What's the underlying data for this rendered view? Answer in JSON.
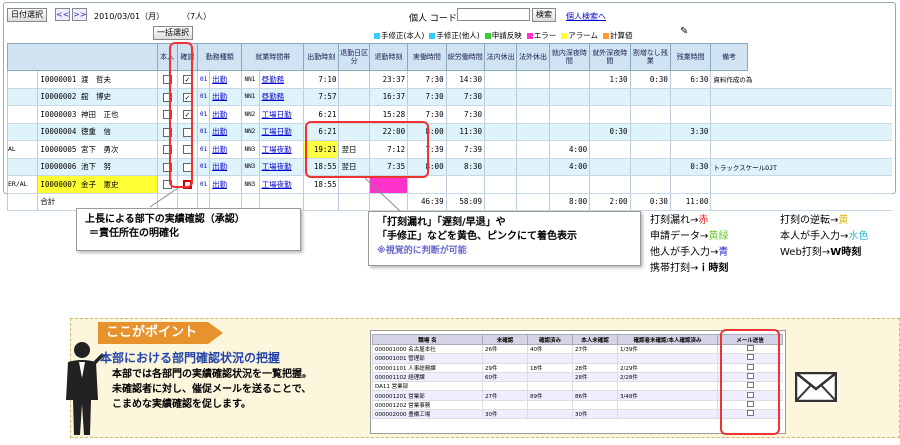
{
  "toolbar": {
    "date_select": "日付選択",
    "prev": "<<",
    "next": ">>",
    "date": "2010/03/01（月）",
    "count": "（7人）",
    "individual_code": "個人 コード",
    "search": "検索",
    "person_search": "個人検索へ",
    "bulk_select": "一括選択"
  },
  "legend": [
    {
      "label": "手修正(本人)",
      "color": "#33ccff"
    },
    {
      "label": "手修正(他人)",
      "color": "#33ccff"
    },
    {
      "label": "申請反映",
      "color": "#33cc33"
    },
    {
      "label": "エラー",
      "color": "#ff33cc"
    },
    {
      "label": "アラーム",
      "color": "#ffff33"
    },
    {
      "label": "計算値",
      "color": "#ff9933"
    }
  ],
  "columns": [
    "本人",
    "確認",
    "勤務種類",
    "就業時間帯",
    "出勤時刻",
    "退勤日区分",
    "退勤時刻",
    "実働時間",
    "総労働時間",
    "法内休出",
    "法外休出",
    "就内深夜時間",
    "就外深夜時間",
    "割増なし残業",
    "残業時間",
    "備考"
  ],
  "rows": [
    {
      "pre": "",
      "id": "I0000001",
      "name": "渡　哲夫",
      "confirm": "✓",
      "c1": "01",
      "kind": "出勤",
      "code": "NN1",
      "zone": "昼勤務",
      "in": "7:10",
      "day": "",
      "out": "23:37",
      "work": "7:30",
      "total": "14:30",
      "h1": "",
      "h2": "",
      "n1": "",
      "n2": "1:30",
      "ot0": "0:30",
      "ot": "6:30",
      "note": "資料作成の為"
    },
    {
      "pre": "",
      "id": "I0000002",
      "name": "舘　博史",
      "confirm": "✓",
      "c1": "01",
      "kind": "出勤",
      "code": "NN1",
      "zone": "昼勤務",
      "in": "7:57",
      "day": "",
      "out": "16:37",
      "work": "7:30",
      "total": "7:30",
      "h1": "",
      "h2": "",
      "n1": "",
      "n2": "",
      "ot0": "",
      "ot": "",
      "note": ""
    },
    {
      "pre": "",
      "id": "I0000003",
      "name": "神田　正也",
      "confirm": "✓",
      "c1": "01",
      "kind": "出勤",
      "code": "NN2",
      "zone": "工場日勤",
      "in": "6:21",
      "day": "",
      "out": "15:28",
      "work": "7:30",
      "total": "7:30",
      "h1": "",
      "h2": "",
      "n1": "",
      "n2": "",
      "ot0": "",
      "ot": "",
      "note": ""
    },
    {
      "pre": "",
      "id": "I0000004",
      "name": "徳重　信",
      "confirm": "",
      "c1": "01",
      "kind": "出勤",
      "code": "NN2",
      "zone": "工場日勤",
      "in": "6:21",
      "day": "",
      "out": "22:00",
      "work": "8:00",
      "total": "11:30",
      "h1": "",
      "h2": "",
      "n1": "",
      "n2": "0:30",
      "ot0": "",
      "ot": "3:30",
      "note": ""
    },
    {
      "pre": "AL",
      "id": "I0000005",
      "name": "宮下　勇次",
      "confirm": "",
      "c1": "01",
      "kind": "出勤",
      "code": "NN3",
      "zone": "工場夜勤",
      "in": "19:21",
      "day": "翌日",
      "out": "7:12",
      "work": "7:39",
      "total": "7:39",
      "h1": "",
      "h2": "",
      "n1": "4:00",
      "n2": "",
      "ot0": "",
      "ot": "",
      "note": ""
    },
    {
      "pre": "",
      "id": "I0000006",
      "name": "池下　努",
      "confirm": "",
      "c1": "01",
      "kind": "出勤",
      "code": "NN3",
      "zone": "工場夜勤",
      "in": "18:55",
      "day": "翌日",
      "out": "7:35",
      "work": "8:00",
      "total": "8:30",
      "h1": "",
      "h2": "",
      "n1": "4:00",
      "n2": "",
      "ot0": "",
      "ot": "0:30",
      "note": "トラックスケールOJT"
    },
    {
      "pre": "ER/AL",
      "id": "I0000007",
      "name": "金子　憲史",
      "confirm": "",
      "c1": "01",
      "kind": "出勤",
      "code": "NN3",
      "zone": "工場夜勤",
      "in": "18:55",
      "day": "",
      "out": "",
      "work": "",
      "total": "",
      "h1": "",
      "h2": "",
      "n1": "",
      "n2": "",
      "ot0": "",
      "ot": "",
      "note": ""
    }
  ],
  "total": {
    "label": "合計",
    "work": "46:39",
    "total": "58:09",
    "n1": "8:00",
    "n2": "2:00",
    "ot0": "0:30",
    "ot": "11:00"
  },
  "callout1": {
    "line1": "上長による部下の実績確認（承認）",
    "line2": "＝責任所在の明確化"
  },
  "callout2": {
    "line1": "「打刻漏れ」「遅刻/早退」や",
    "line2": "「手修正」などを黄色、ピンクにて着色表示",
    "line3": "※視覚的に判断が可能"
  },
  "colorkey": {
    "a1": "打刻漏れ→",
    "a1c": "赤",
    "a2": "申請データ→",
    "a2c": "黄緑",
    "a3": "他人が手入力→",
    "a3c": "青",
    "a4": "携帯打刻→",
    "a4c": "ｉ時刻",
    "b1": "打刻の逆転→",
    "b1c": "黄",
    "b2": "本人が手入力→",
    "b2c": "水色",
    "b3": "Web打刻→",
    "b3c": "W時刻"
  },
  "point": {
    "badge": "ここがポイント",
    "heading": "本部における部門確認状況の把握",
    "body1": "本部では各部門の実績確認状況を一覧把握。",
    "body2": "未確認者に対し、催促メールを送ることで、",
    "body3": "こまめな実績確認を促します。"
  },
  "dept_columns": [
    "職場 名",
    "未確認",
    "確認済み",
    "本人未確認",
    "確認者未確認/本人確認済み",
    "メール送信"
  ],
  "dept_rows": [
    {
      "code": "000001000",
      "name": "名古屋本社",
      "u": "26件",
      "c": "40件",
      "p": "27件",
      "r": "1/39件"
    },
    {
      "code": "000001001",
      "name": "管理部",
      "u": "",
      "c": "",
      "p": "",
      "r": ""
    },
    {
      "code": "000001101",
      "name": "人事総務課",
      "u": "29件",
      "c": "18件",
      "p": "28件",
      "r": "2/29件"
    },
    {
      "code": "000001102",
      "name": "経理課",
      "u": "60件",
      "c": "",
      "p": "28件",
      "r": "2/28件"
    },
    {
      "code": "DA11",
      "name": "営業部",
      "u": "",
      "c": "",
      "p": "",
      "r": ""
    },
    {
      "code": "000001201",
      "name": "営業部",
      "u": "27件",
      "c": "89件",
      "p": "86件",
      "r": "3/48件"
    },
    {
      "code": "000001202",
      "name": "営業事務",
      "u": "",
      "c": "",
      "p": "",
      "r": ""
    },
    {
      "code": "000002000",
      "name": "豊橋工場",
      "u": "30件",
      "c": "",
      "p": "30件",
      "r": ""
    }
  ]
}
